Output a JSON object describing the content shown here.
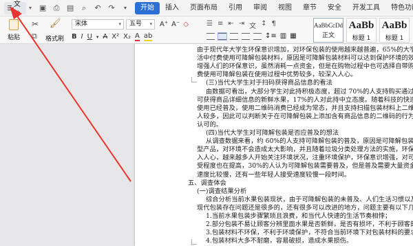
{
  "titlebar": {
    "file_label": "文件",
    "tabs": [
      "开始",
      "插入",
      "页面布局",
      "引用",
      "审阅",
      "视图",
      "章节",
      "安全",
      "开发工具",
      "特色功能"
    ]
  },
  "ribbon": {
    "paste_label": "粘贴",
    "format_painter_label": "格式刷",
    "font_name": "宋体",
    "font_size": "五号",
    "bold": "B",
    "italic": "I",
    "underline": "U",
    "styles": [
      {
        "sample": "AaBbCcDd",
        "name": "正文"
      },
      {
        "sample": "AaBb",
        "name": "标题 1"
      },
      {
        "sample": "AaBb",
        "name": "标题 1"
      }
    ]
  },
  "document": {
    "lines": [
      "由于现代年大学生环保意识增加，对环保包装的使用越来越普遍，65%的大学生会购买生",
      "活中付费使用可降解包装材料，原因是可降解包装材料可以达到保护环境的效果，并且可以",
      "增强人们的环保意识，虽然消耗一点资金，但是在购物过程中也可选择自带购物袋。由于付",
      "费使用可降解包装在使用过程中优势较多，较深入人心。",
      "(三)当代大学生对于扫码获得商品信息的看法",
      "由数据可看出，大部分学生对此持积极态度，超过 70%的人支持购买通过扫描二维码就",
      "可获得商品详细信息的新鲜水果，17%的人对此持中立态度。随着科技的快速发展，二维码",
      "使用已经普及，使用二维码消费已经成为常态，并且支持扫描包装材料上二维码获得信息的",
      "人较多，因此可以判断关于在可降解包装上添加含有商品信息的二维码的行为是比较被",
      "认可的。",
      "(四)当代大学生对可降解包装是否应普及的想法",
      "从调查数据来看，约 60%的人支持可降解包装的普及，原因是可降解包装属于环境友好",
      "型产品，对环境不会造成太大影响，并且随着垃圾分类处理方法的实施，环保理念越来越深",
      "入人心，越来越多人开始关注环境状况，注重环境保护，环保意识增强，对可降解包装的接",
      "受程度也在提高，30%的人认为可降解包装需要普及，但是普及需要大量资金和时间，并且",
      "速度比较慢，还有一些年轻人接受速度较慢一段时间。",
      "五、调查体会",
      "(一)调查结果分析",
      "综合分析当前水果包装现状，由于可降解包装的未普及、人们生活习惯以及认知等原因，",
      "现代包装存在问题还是很多的，还有很多可以改进的地方，问题主要有以下几点：",
      "1.当前水果包装步骤繁琐且浪费，和当代人快速的生活节奏相悖；",
      "2.部分包装不易让顾客分辨里面水果是否新鲜，是否有损坏，不利于顾客的选择；",
      "3.包装材料不环保，不利于环境保护，不符合当前环境下对包装材料的要求；",
      "4.包装材料大多不耐磨，容易破损，造成水果损伤。"
    ]
  },
  "colors": {
    "accent": "#2b6fd6",
    "arrow": "#e8352f"
  }
}
